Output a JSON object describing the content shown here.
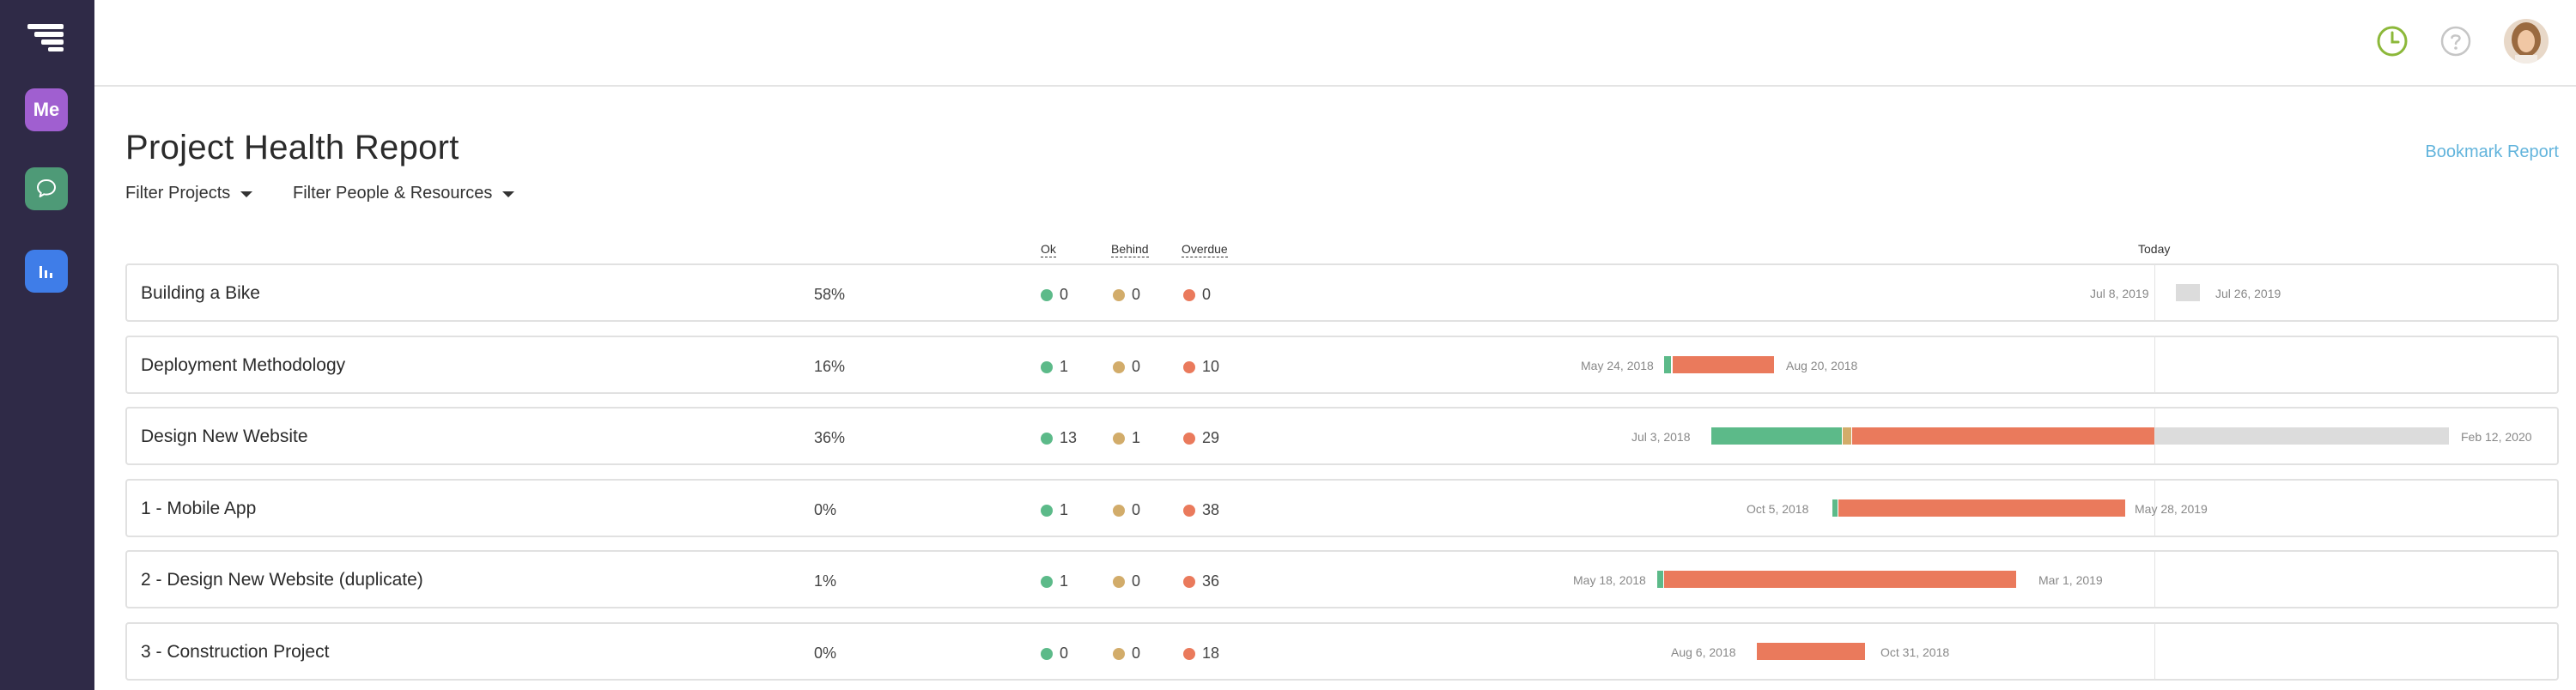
{
  "header": {
    "title": "Project Health Report",
    "bookmark_label": "Bookmark Report"
  },
  "filters": {
    "projects_label": "Filter Projects",
    "people_label": "Filter People & Resources"
  },
  "sidebar": {
    "me_label": "Me"
  },
  "columns": {
    "ok": "Ok",
    "behind": "Behind",
    "overdue": "Overdue",
    "today": "Today"
  },
  "colors": {
    "ok": "#5cba89",
    "behind": "#d2ac6a",
    "overdue": "#ea7a5c",
    "future": "#dcdcdc"
  },
  "projects": [
    {
      "name": "Building a Bike",
      "percent": "58%",
      "ok": "0",
      "behind": "0",
      "overdue": "0",
      "start": "Jul 8, 2019",
      "end": "Jul 26, 2019"
    },
    {
      "name": "Deployment Methodology",
      "percent": "16%",
      "ok": "1",
      "behind": "0",
      "overdue": "10",
      "start": "May 24, 2018",
      "end": "Aug 20, 2018"
    },
    {
      "name": "Design New Website",
      "percent": "36%",
      "ok": "13",
      "behind": "1",
      "overdue": "29",
      "start": "Jul 3, 2018",
      "end": "Feb 12, 2020"
    },
    {
      "name": "1 - Mobile App",
      "percent": "0%",
      "ok": "1",
      "behind": "0",
      "overdue": "38",
      "start": "Oct 5, 2018",
      "end": "May 28, 2019"
    },
    {
      "name": "2 - Design New Website (duplicate)",
      "percent": "1%",
      "ok": "1",
      "behind": "0",
      "overdue": "36",
      "start": "May 18, 2018",
      "end": "Mar 1, 2019"
    },
    {
      "name": "3 - Construction Project",
      "percent": "0%",
      "ok": "0",
      "behind": "0",
      "overdue": "18",
      "start": "Aug 6, 2018",
      "end": "Oct 31, 2018"
    }
  ],
  "icons": {
    "logo": "logo-icon",
    "chat": "chat-icon",
    "reports": "bar-chart-icon",
    "timer": "clock-icon",
    "help": "help-icon",
    "avatar": "user-avatar"
  }
}
